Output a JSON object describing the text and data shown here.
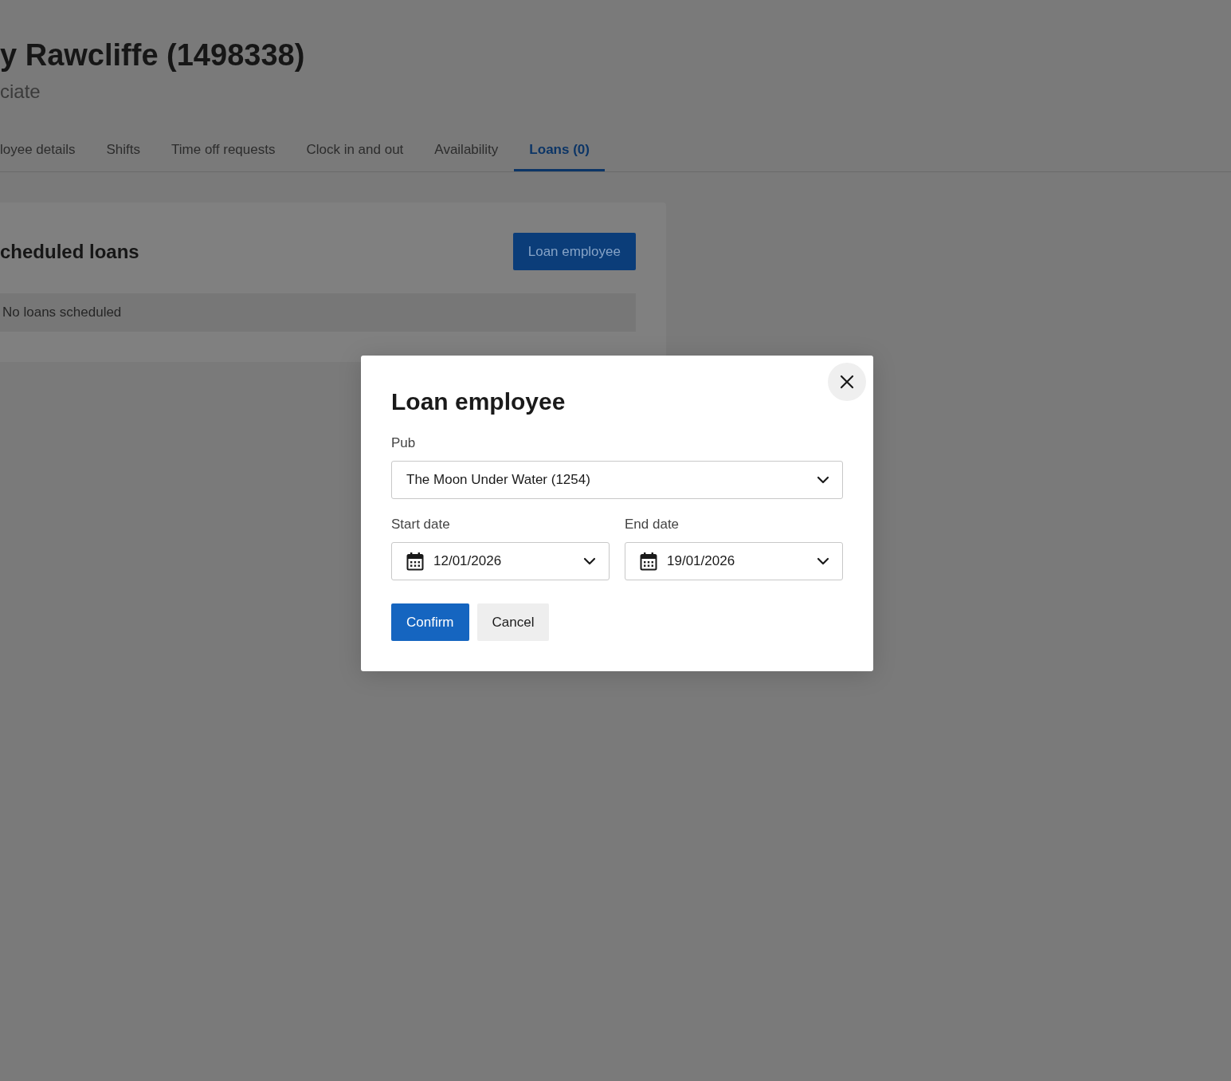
{
  "page": {
    "title": "y Rawcliffe (1498338)",
    "subtitle": "ciate"
  },
  "tabs": [
    {
      "label": "loyee details",
      "selected": false
    },
    {
      "label": "Shifts",
      "selected": false
    },
    {
      "label": "Time off requests",
      "selected": false
    },
    {
      "label": "Clock in and out",
      "selected": false
    },
    {
      "label": "Availability",
      "selected": false
    },
    {
      "label": "Loans (0)",
      "selected": true
    }
  ],
  "loans_card": {
    "heading": "cheduled loans",
    "button": "Loan employee",
    "empty_message": "No loans scheduled"
  },
  "modal": {
    "title": "Loan employee",
    "fields": [
      {
        "kind": "select",
        "label": "Pub",
        "value": "The Moon Under Water (1254)"
      },
      {
        "kind": "date",
        "label": "Start date",
        "value": "12/01/2026"
      },
      {
        "kind": "date",
        "label": "End date",
        "value": "19/01/2026"
      }
    ],
    "buttons": [
      {
        "label": "Confirm",
        "kind": "primary"
      },
      {
        "label": "Cancel",
        "kind": "secondary"
      }
    ]
  }
}
